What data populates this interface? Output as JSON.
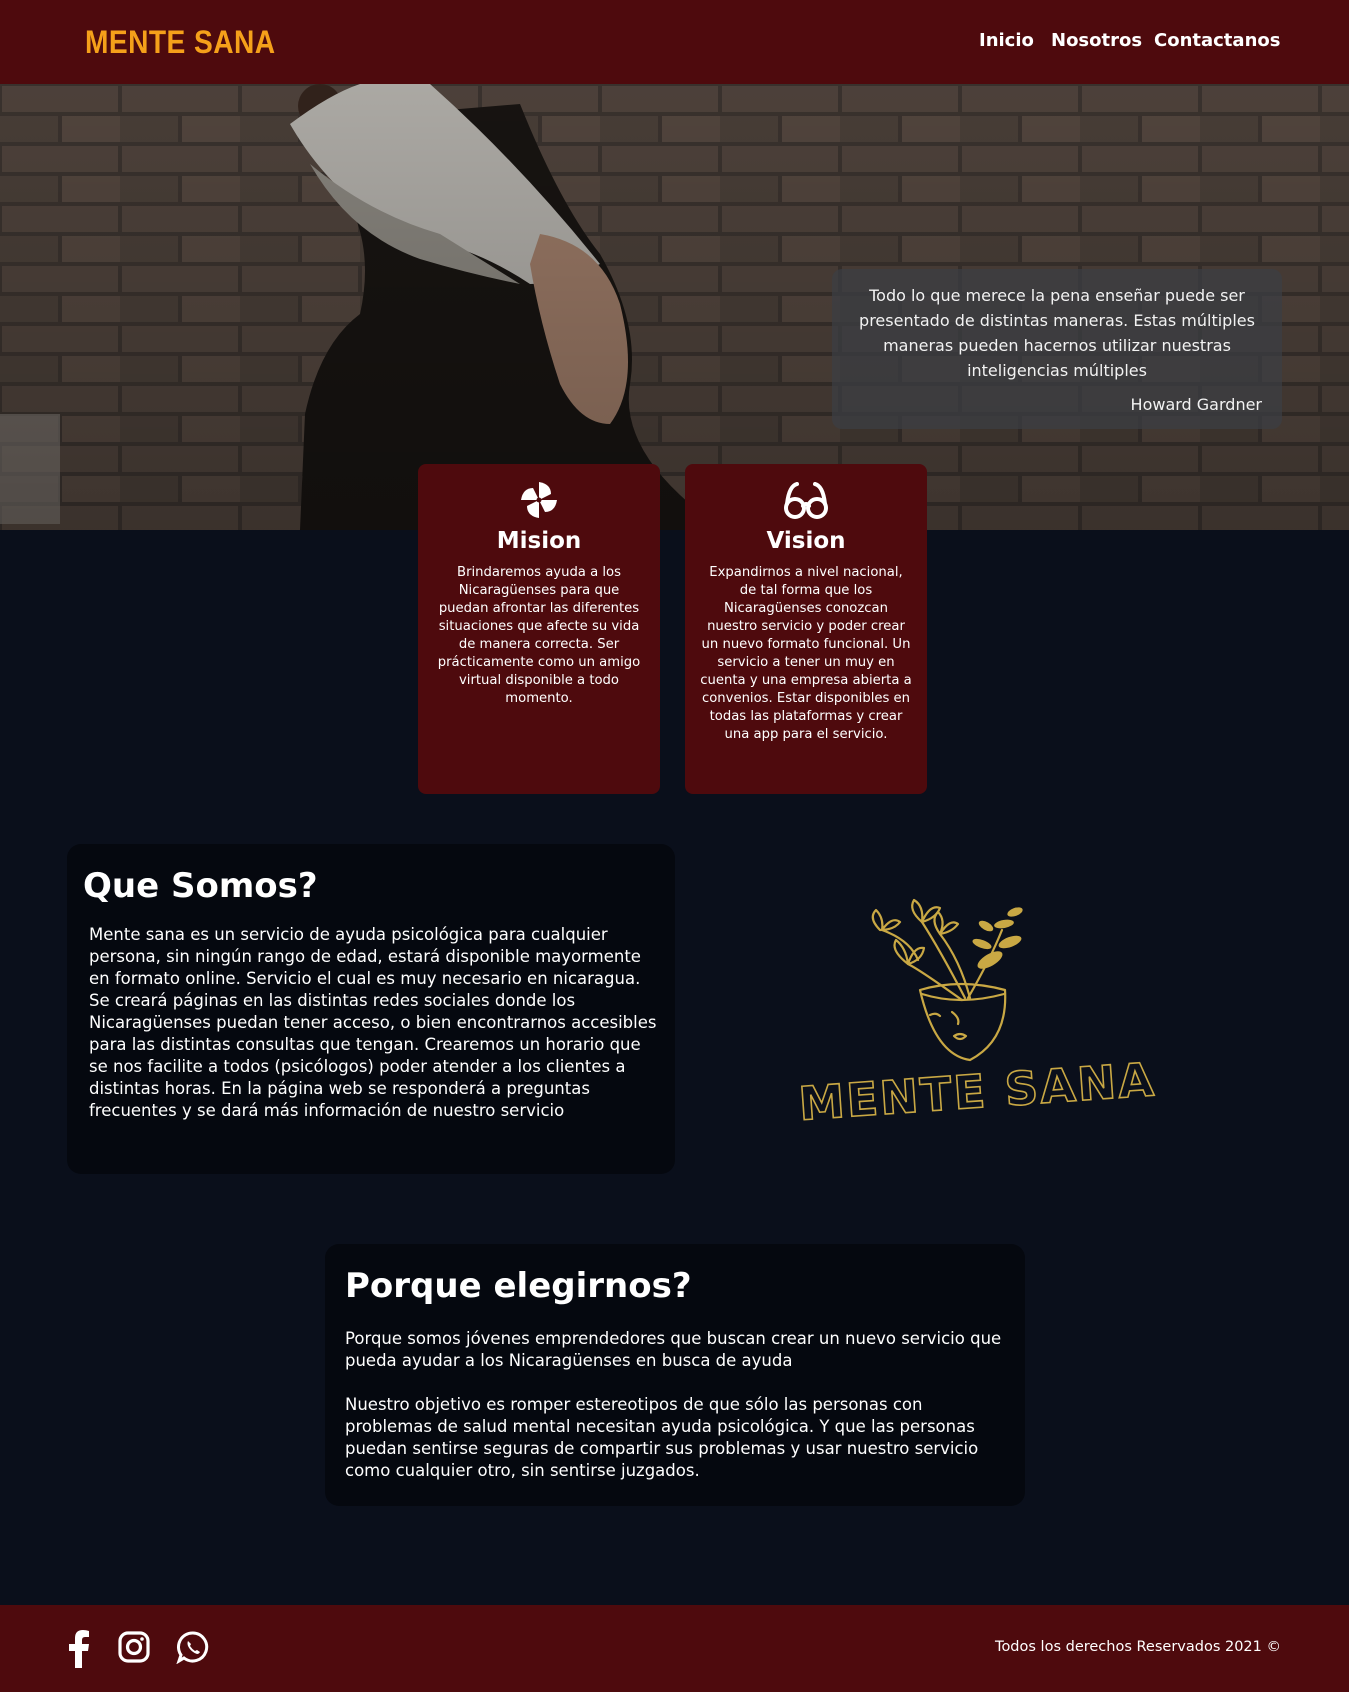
{
  "navbar": {
    "brand": "MENTE SANA",
    "links": [
      "Inicio",
      "Nosotros",
      "Contactanos"
    ]
  },
  "hero": {
    "quote": "Todo lo que merece la pena enseñar puede ser presentado de distintas maneras. Estas múltiples maneras pueden hacernos utilizar nuestras inteligencias múltiples",
    "author": "Howard Gardner"
  },
  "cards": {
    "mision": {
      "icon": "pinwheel-icon",
      "title": "Mision",
      "text": "Brindaremos ayuda a los Nicaragüenses para que puedan afrontar las diferentes situaciones que afecte su vida de manera correcta. Ser prácticamente como un amigo virtual disponible a todo momento."
    },
    "vision": {
      "icon": "glasses-icon",
      "title": "Vision",
      "text": "Expandirnos a nivel nacional, de tal forma que los Nicaragüenses conozcan nuestro servicio y poder crear un nuevo formato funcional. Un servicio a tener un muy en cuenta y una empresa abierta a convenios. Estar disponibles en todas las plataformas y crear una app para el servicio."
    }
  },
  "somos": {
    "title": "Que Somos?",
    "text": "Mente sana es un servicio de ayuda psicológica para cualquier persona, sin ningún rango de edad, estará disponible mayormente en formato online. Servicio el cual es muy necesario en nicaragua. Se creará páginas en las distintas redes sociales donde los Nicaragüenses puedan tener acceso, o bien encontrarnos accesibles para las distintas consultas que tengan. Crearemos un horario que se nos facilite a todos (psicólogos) poder atender a los clientes a distintas horas. En la página web se responderá a preguntas frecuentes y se dará más información de nuestro servicio",
    "logo_text": "MENTE SANA"
  },
  "porque": {
    "title": "Porque elegirnos?",
    "p1": "Porque somos jóvenes emprendedores que buscan crear un nuevo servicio que pueda ayudar a los Nicaragüenses en busca de ayuda",
    "p2": "Nuestro objetivo es romper estereotipos de que sólo las personas con problemas de salud mental necesitan ayuda psicológica. Y que las personas puedan sentirse seguras de compartir sus problemas y usar nuestro servicio como cualquier otro, sin sentirse juzgados."
  },
  "footer": {
    "icons": [
      "facebook-icon",
      "instagram-icon",
      "whatsapp-icon"
    ],
    "copyright": "Todos los derechos Reservados 2021 ©"
  },
  "colors": {
    "brand": "#f5a01a",
    "bar": "#4e0a0d",
    "background": "#0a0f1b",
    "logo_gold": "#c9a844"
  }
}
